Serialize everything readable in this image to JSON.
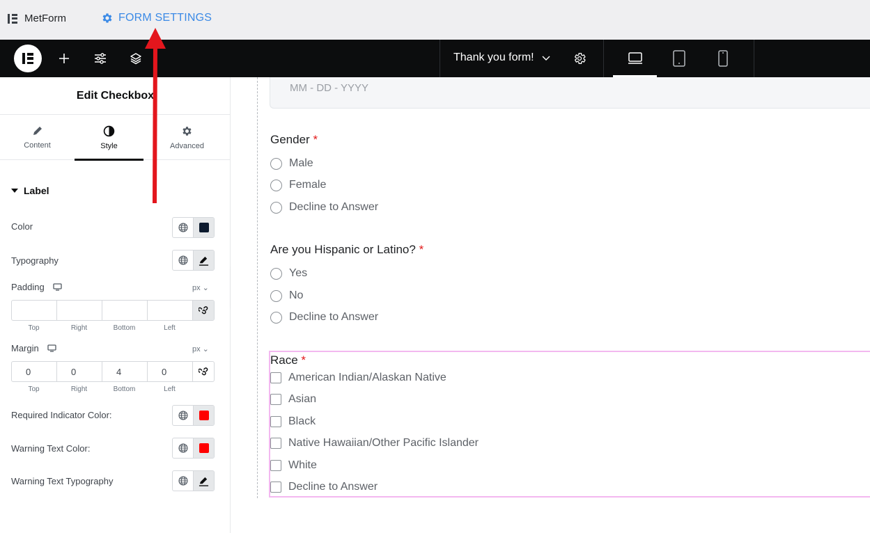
{
  "topbar": {
    "app_name": "MetForm",
    "form_settings_label": "FORM SETTINGS"
  },
  "navbar": {
    "document_title": "Thank you form!",
    "add_icon": "plus-icon",
    "settings_icon": "sliders-icon",
    "layers_icon": "layers-icon"
  },
  "panel": {
    "title": "Edit Checkbox",
    "tabs": [
      {
        "label": "Content",
        "icon": "pencil-icon"
      },
      {
        "label": "Style",
        "icon": "contrast-icon"
      },
      {
        "label": "Advanced",
        "icon": "gear-icon"
      }
    ],
    "active_tab": "Style",
    "section_label": "Label",
    "color_label": "Color",
    "color_value": "#0c1a2e",
    "typography_label": "Typography",
    "padding": {
      "label": "Padding",
      "unit": "px",
      "values": [
        "",
        "",
        "",
        ""
      ],
      "sides": [
        "Top",
        "Right",
        "Bottom",
        "Left"
      ]
    },
    "margin": {
      "label": "Margin",
      "unit": "px",
      "values": [
        "0",
        "0",
        "4",
        "0"
      ],
      "sides": [
        "Top",
        "Right",
        "Bottom",
        "Left"
      ]
    },
    "required_indicator_label": "Required Indicator Color:",
    "required_indicator_color": "#ff0000",
    "warning_text_color_label": "Warning Text Color:",
    "warning_text_color": "#ff0000",
    "warning_typography_label": "Warning Text Typography"
  },
  "form": {
    "date_placeholder": "MM - DD - YYYY",
    "required_mark": "*",
    "gender": {
      "label": "Gender",
      "options": [
        "Male",
        "Female",
        "Decline to Answer"
      ]
    },
    "hispanic": {
      "label": "Are you Hispanic or Latino?",
      "options": [
        "Yes",
        "No",
        "Decline to Answer"
      ]
    },
    "race": {
      "label": "Race",
      "options": [
        "American Indian/Alaskan Native",
        "Asian",
        "Black",
        "Native Hawaiian/Other Pacific Islander",
        "White",
        "Decline to Answer"
      ]
    }
  },
  "colors": {
    "accent": "#3b8ae6",
    "annotation_arrow": "#e3161d",
    "selected_outline": "#f3b8f0"
  }
}
